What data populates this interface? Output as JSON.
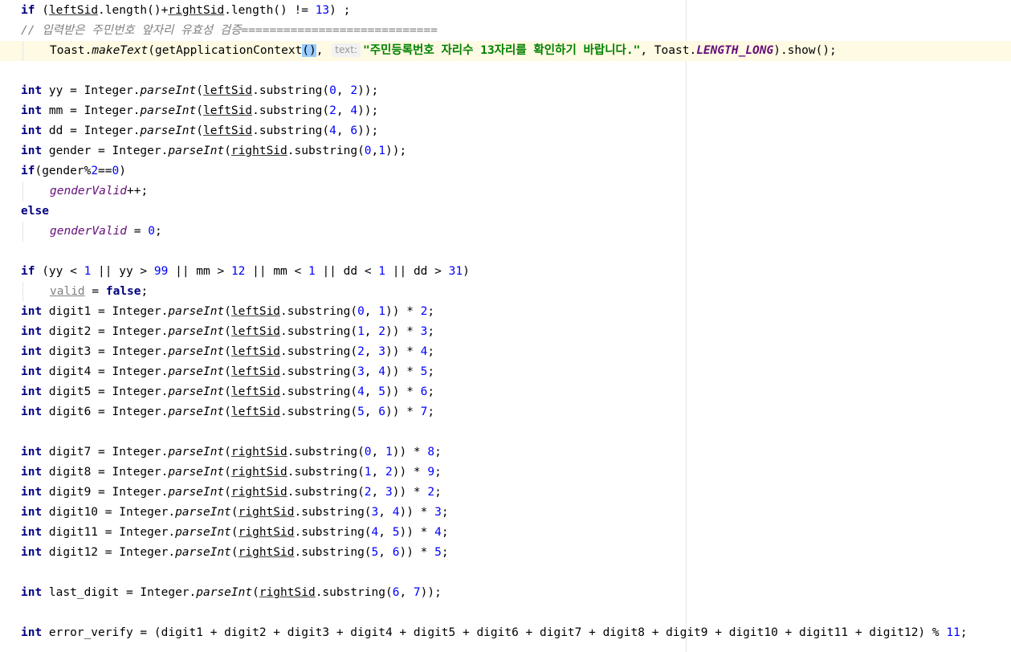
{
  "editor": {
    "lines": [
      {
        "id": "l1",
        "segments": [
          [
            "kw",
            "if"
          ],
          [
            "p",
            " ("
          ],
          [
            "ul",
            "leftSid"
          ],
          [
            "p",
            ".length()+"
          ],
          [
            "ul",
            "rightSid"
          ],
          [
            "p",
            ".length() != "
          ],
          [
            "num",
            "13"
          ],
          [
            "p",
            ") ;"
          ]
        ]
      },
      {
        "id": "l2",
        "segments": [
          [
            "comment",
            "// 입력받은 주민번호 앞자리 유효성 검증============================"
          ]
        ]
      },
      {
        "id": "l3",
        "indent": 1,
        "current": true,
        "segments": [
          [
            "p",
            "Toast."
          ],
          [
            "ital",
            "makeText"
          ],
          [
            "p",
            "(getApplicationContext"
          ],
          [
            "match",
            "()"
          ],
          [
            "p",
            ", "
          ],
          [
            "hint",
            "text:"
          ],
          [
            "str",
            "\"주민등록번호 자리수 13자리를 확인하기 바랍니다.\""
          ],
          [
            "p",
            ", Toast."
          ],
          [
            "constant",
            "LENGTH_LONG"
          ],
          [
            "p",
            ").show();"
          ]
        ]
      },
      {
        "id": "l4",
        "segments": []
      },
      {
        "id": "l5",
        "segments": [
          [
            "kw",
            "int"
          ],
          [
            "p",
            " yy = Integer."
          ],
          [
            "ital",
            "parseInt"
          ],
          [
            "p",
            "("
          ],
          [
            "ul",
            "leftSid"
          ],
          [
            "p",
            ".substring("
          ],
          [
            "num",
            "0"
          ],
          [
            "p",
            ", "
          ],
          [
            "num",
            "2"
          ],
          [
            "p",
            "));"
          ]
        ]
      },
      {
        "id": "l6",
        "segments": [
          [
            "kw",
            "int"
          ],
          [
            "p",
            " mm = Integer."
          ],
          [
            "ital",
            "parseInt"
          ],
          [
            "p",
            "("
          ],
          [
            "ul",
            "leftSid"
          ],
          [
            "p",
            ".substring("
          ],
          [
            "num",
            "2"
          ],
          [
            "p",
            ", "
          ],
          [
            "num",
            "4"
          ],
          [
            "p",
            "));"
          ]
        ]
      },
      {
        "id": "l7",
        "segments": [
          [
            "kw",
            "int"
          ],
          [
            "p",
            " dd = Integer."
          ],
          [
            "ital",
            "parseInt"
          ],
          [
            "p",
            "("
          ],
          [
            "ul",
            "leftSid"
          ],
          [
            "p",
            ".substring("
          ],
          [
            "num",
            "4"
          ],
          [
            "p",
            ", "
          ],
          [
            "num",
            "6"
          ],
          [
            "p",
            "));"
          ]
        ]
      },
      {
        "id": "l8",
        "segments": [
          [
            "kw",
            "int"
          ],
          [
            "p",
            " gender = Integer."
          ],
          [
            "ital",
            "parseInt"
          ],
          [
            "p",
            "("
          ],
          [
            "ul",
            "rightSid"
          ],
          [
            "p",
            ".substring("
          ],
          [
            "num",
            "0"
          ],
          [
            "p",
            ","
          ],
          [
            "num",
            "1"
          ],
          [
            "p",
            "));"
          ]
        ]
      },
      {
        "id": "l9",
        "segments": [
          [
            "kw",
            "if"
          ],
          [
            "p",
            "(gender%"
          ],
          [
            "num",
            "2"
          ],
          [
            "p",
            "=="
          ],
          [
            "num",
            "0"
          ],
          [
            "p",
            ")"
          ]
        ]
      },
      {
        "id": "l10",
        "indent": 1,
        "segments": [
          [
            "field",
            "genderValid"
          ],
          [
            "p",
            "++;"
          ]
        ]
      },
      {
        "id": "l11",
        "segments": [
          [
            "kw",
            "else"
          ]
        ]
      },
      {
        "id": "l12",
        "indent": 1,
        "segments": [
          [
            "field",
            "genderValid"
          ],
          [
            "p",
            " = "
          ],
          [
            "num",
            "0"
          ],
          [
            "p",
            ";"
          ]
        ]
      },
      {
        "id": "l13",
        "segments": []
      },
      {
        "id": "l14",
        "segments": [
          [
            "kw",
            "if"
          ],
          [
            "p",
            " (yy < "
          ],
          [
            "num",
            "1"
          ],
          [
            "p",
            " || yy > "
          ],
          [
            "num",
            "99"
          ],
          [
            "p",
            " || mm > "
          ],
          [
            "num",
            "12"
          ],
          [
            "p",
            " || mm < "
          ],
          [
            "num",
            "1"
          ],
          [
            "p",
            " || dd < "
          ],
          [
            "num",
            "1"
          ],
          [
            "p",
            " || dd > "
          ],
          [
            "num",
            "31"
          ],
          [
            "p",
            ")"
          ]
        ]
      },
      {
        "id": "l15",
        "indent": 1,
        "segments": [
          [
            "unused",
            "valid"
          ],
          [
            "p",
            " = "
          ],
          [
            "kw",
            "false"
          ],
          [
            "p",
            ";"
          ]
        ]
      },
      {
        "id": "l16",
        "segments": [
          [
            "kw",
            "int"
          ],
          [
            "p",
            " digit1 = Integer."
          ],
          [
            "ital",
            "parseInt"
          ],
          [
            "p",
            "("
          ],
          [
            "ul",
            "leftSid"
          ],
          [
            "p",
            ".substring("
          ],
          [
            "num",
            "0"
          ],
          [
            "p",
            ", "
          ],
          [
            "num",
            "1"
          ],
          [
            "p",
            ")) * "
          ],
          [
            "num",
            "2"
          ],
          [
            "p",
            ";"
          ]
        ]
      },
      {
        "id": "l17",
        "segments": [
          [
            "kw",
            "int"
          ],
          [
            "p",
            " digit2 = Integer."
          ],
          [
            "ital",
            "parseInt"
          ],
          [
            "p",
            "("
          ],
          [
            "ul",
            "leftSid"
          ],
          [
            "p",
            ".substring("
          ],
          [
            "num",
            "1"
          ],
          [
            "p",
            ", "
          ],
          [
            "num",
            "2"
          ],
          [
            "p",
            ")) * "
          ],
          [
            "num",
            "3"
          ],
          [
            "p",
            ";"
          ]
        ]
      },
      {
        "id": "l18",
        "segments": [
          [
            "kw",
            "int"
          ],
          [
            "p",
            " digit3 = Integer."
          ],
          [
            "ital",
            "parseInt"
          ],
          [
            "p",
            "("
          ],
          [
            "ul",
            "leftSid"
          ],
          [
            "p",
            ".substring("
          ],
          [
            "num",
            "2"
          ],
          [
            "p",
            ", "
          ],
          [
            "num",
            "3"
          ],
          [
            "p",
            ")) * "
          ],
          [
            "num",
            "4"
          ],
          [
            "p",
            ";"
          ]
        ]
      },
      {
        "id": "l19",
        "segments": [
          [
            "kw",
            "int"
          ],
          [
            "p",
            " digit4 = Integer."
          ],
          [
            "ital",
            "parseInt"
          ],
          [
            "p",
            "("
          ],
          [
            "ul",
            "leftSid"
          ],
          [
            "p",
            ".substring("
          ],
          [
            "num",
            "3"
          ],
          [
            "p",
            ", "
          ],
          [
            "num",
            "4"
          ],
          [
            "p",
            ")) * "
          ],
          [
            "num",
            "5"
          ],
          [
            "p",
            ";"
          ]
        ]
      },
      {
        "id": "l20",
        "segments": [
          [
            "kw",
            "int"
          ],
          [
            "p",
            " digit5 = Integer."
          ],
          [
            "ital",
            "parseInt"
          ],
          [
            "p",
            "("
          ],
          [
            "ul",
            "leftSid"
          ],
          [
            "p",
            ".substring("
          ],
          [
            "num",
            "4"
          ],
          [
            "p",
            ", "
          ],
          [
            "num",
            "5"
          ],
          [
            "p",
            ")) * "
          ],
          [
            "num",
            "6"
          ],
          [
            "p",
            ";"
          ]
        ]
      },
      {
        "id": "l21",
        "segments": [
          [
            "kw",
            "int"
          ],
          [
            "p",
            " digit6 = Integer."
          ],
          [
            "ital",
            "parseInt"
          ],
          [
            "p",
            "("
          ],
          [
            "ul",
            "leftSid"
          ],
          [
            "p",
            ".substring("
          ],
          [
            "num",
            "5"
          ],
          [
            "p",
            ", "
          ],
          [
            "num",
            "6"
          ],
          [
            "p",
            ")) * "
          ],
          [
            "num",
            "7"
          ],
          [
            "p",
            ";"
          ]
        ]
      },
      {
        "id": "l22",
        "segments": []
      },
      {
        "id": "l23",
        "segments": [
          [
            "kw",
            "int"
          ],
          [
            "p",
            " digit7 = Integer."
          ],
          [
            "ital",
            "parseInt"
          ],
          [
            "p",
            "("
          ],
          [
            "ul",
            "rightSid"
          ],
          [
            "p",
            ".substring("
          ],
          [
            "num",
            "0"
          ],
          [
            "p",
            ", "
          ],
          [
            "num",
            "1"
          ],
          [
            "p",
            ")) * "
          ],
          [
            "num",
            "8"
          ],
          [
            "p",
            ";"
          ]
        ]
      },
      {
        "id": "l24",
        "segments": [
          [
            "kw",
            "int"
          ],
          [
            "p",
            " digit8 = Integer."
          ],
          [
            "ital",
            "parseInt"
          ],
          [
            "p",
            "("
          ],
          [
            "ul",
            "rightSid"
          ],
          [
            "p",
            ".substring("
          ],
          [
            "num",
            "1"
          ],
          [
            "p",
            ", "
          ],
          [
            "num",
            "2"
          ],
          [
            "p",
            ")) * "
          ],
          [
            "num",
            "9"
          ],
          [
            "p",
            ";"
          ]
        ]
      },
      {
        "id": "l25",
        "segments": [
          [
            "kw",
            "int"
          ],
          [
            "p",
            " digit9 = Integer."
          ],
          [
            "ital",
            "parseInt"
          ],
          [
            "p",
            "("
          ],
          [
            "ul",
            "rightSid"
          ],
          [
            "p",
            ".substring("
          ],
          [
            "num",
            "2"
          ],
          [
            "p",
            ", "
          ],
          [
            "num",
            "3"
          ],
          [
            "p",
            ")) * "
          ],
          [
            "num",
            "2"
          ],
          [
            "p",
            ";"
          ]
        ]
      },
      {
        "id": "l26",
        "segments": [
          [
            "kw",
            "int"
          ],
          [
            "p",
            " digit10 = Integer."
          ],
          [
            "ital",
            "parseInt"
          ],
          [
            "p",
            "("
          ],
          [
            "ul",
            "rightSid"
          ],
          [
            "p",
            ".substring("
          ],
          [
            "num",
            "3"
          ],
          [
            "p",
            ", "
          ],
          [
            "num",
            "4"
          ],
          [
            "p",
            ")) * "
          ],
          [
            "num",
            "3"
          ],
          [
            "p",
            ";"
          ]
        ]
      },
      {
        "id": "l27",
        "segments": [
          [
            "kw",
            "int"
          ],
          [
            "p",
            " digit11 = Integer."
          ],
          [
            "ital",
            "parseInt"
          ],
          [
            "p",
            "("
          ],
          [
            "ul",
            "rightSid"
          ],
          [
            "p",
            ".substring("
          ],
          [
            "num",
            "4"
          ],
          [
            "p",
            ", "
          ],
          [
            "num",
            "5"
          ],
          [
            "p",
            ")) * "
          ],
          [
            "num",
            "4"
          ],
          [
            "p",
            ";"
          ]
        ]
      },
      {
        "id": "l28",
        "segments": [
          [
            "kw",
            "int"
          ],
          [
            "p",
            " digit12 = Integer."
          ],
          [
            "ital",
            "parseInt"
          ],
          [
            "p",
            "("
          ],
          [
            "ul",
            "rightSid"
          ],
          [
            "p",
            ".substring("
          ],
          [
            "num",
            "5"
          ],
          [
            "p",
            ", "
          ],
          [
            "num",
            "6"
          ],
          [
            "p",
            ")) * "
          ],
          [
            "num",
            "5"
          ],
          [
            "p",
            ";"
          ]
        ]
      },
      {
        "id": "l29",
        "segments": []
      },
      {
        "id": "l30",
        "segments": [
          [
            "kw",
            "int"
          ],
          [
            "p",
            " last_digit = Integer."
          ],
          [
            "ital",
            "parseInt"
          ],
          [
            "p",
            "("
          ],
          [
            "ul",
            "rightSid"
          ],
          [
            "p",
            ".substring("
          ],
          [
            "num",
            "6"
          ],
          [
            "p",
            ", "
          ],
          [
            "num",
            "7"
          ],
          [
            "p",
            "));"
          ]
        ]
      },
      {
        "id": "l31",
        "segments": []
      },
      {
        "id": "l32",
        "segments": [
          [
            "kw",
            "int"
          ],
          [
            "p",
            " error_verify = (digit1 + digit2 + digit3 + digit4 + digit5 + digit6 + digit7 + digit8 + digit9 + digit10 + digit11 + digit12) % "
          ],
          [
            "num",
            "11"
          ],
          [
            "p",
            ";"
          ]
        ]
      }
    ]
  },
  "colors": {
    "keyword": "#000080",
    "number": "#0000ff",
    "string": "#008000",
    "comment": "#808080",
    "field": "#660e7a",
    "current_line": "#fffae3",
    "brace_match": "#99ccff"
  }
}
